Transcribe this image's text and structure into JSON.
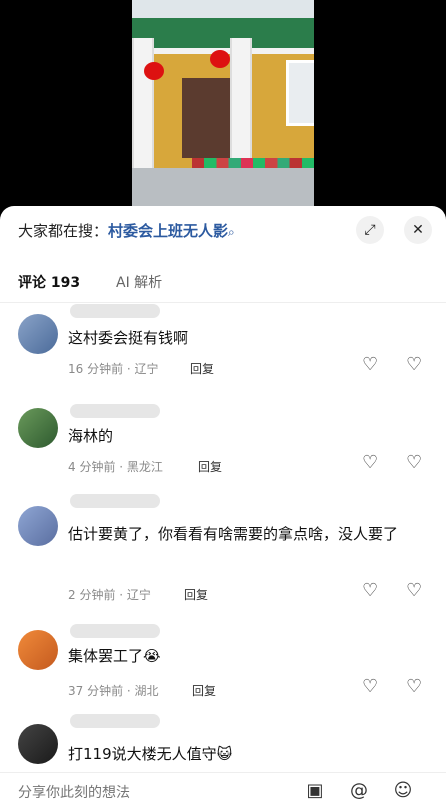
{
  "search": {
    "prefix": "大家都在搜：",
    "query": "村委会上班无人影",
    "icon": "search-icon"
  },
  "tabs": {
    "comments_label": "评论",
    "comments_count": "193",
    "ai_label": "AI 解析"
  },
  "comments": [
    {
      "text": "这村委会挺有钱啊",
      "meta": "16 分钟前 · 辽宁",
      "reply": "回复"
    },
    {
      "text": "海林的",
      "meta": "4 分钟前 · 黑龙江",
      "reply": "回复"
    },
    {
      "text": "估计要黄了，你看看有啥需要的拿点啥，没人要了",
      "meta": "2 分钟前 · 辽宁",
      "reply": "回复"
    },
    {
      "text": "集体罢工了😭",
      "meta": "37 分钟前 · 湖北",
      "reply": "回复"
    },
    {
      "text": "打119说大楼无人值守😺",
      "meta": "",
      "reply": ""
    }
  ],
  "composer": {
    "placeholder": "分享你此刻的想法"
  },
  "colors": {
    "link": "#2c5aa0",
    "muted": "#8a8a8a"
  }
}
